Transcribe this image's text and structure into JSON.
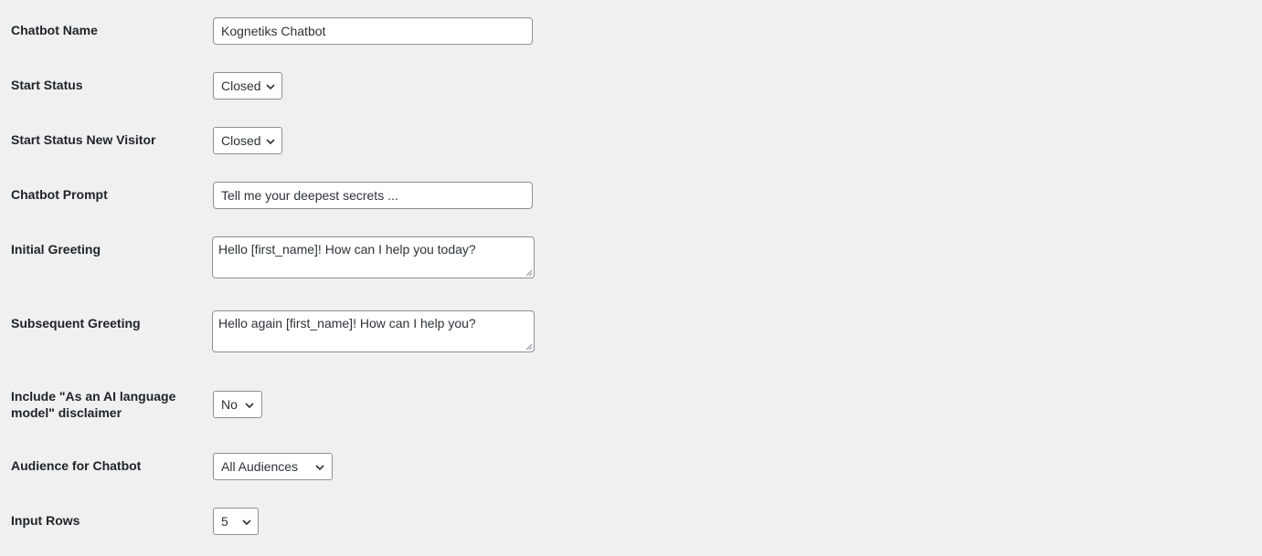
{
  "fields": {
    "chatbot_name": {
      "label": "Chatbot Name",
      "value": "Kognetiks Chatbot"
    },
    "start_status": {
      "label": "Start Status",
      "value": "Closed"
    },
    "start_status_new_visitor": {
      "label": "Start Status New Visitor",
      "value": "Closed"
    },
    "chatbot_prompt": {
      "label": "Chatbot Prompt",
      "value": "Tell me your deepest secrets ..."
    },
    "initial_greeting": {
      "label": "Initial Greeting",
      "value": "Hello [first_name]! How can I help you today?"
    },
    "subsequent_greeting": {
      "label": "Subsequent Greeting",
      "value": "Hello again [first_name]! How can I help you?"
    },
    "disclaimer": {
      "label": "Include \"As an AI language model\" disclaimer",
      "value": "No"
    },
    "audience": {
      "label": "Audience for Chatbot",
      "value": "All Audiences"
    },
    "input_rows": {
      "label": "Input Rows",
      "value": "5"
    }
  },
  "icons": {
    "select_arrow": "chevron-down-icon",
    "resize_grip": "resize-grip-icon"
  },
  "colors": {
    "background": "#f0f0f1",
    "input_border": "#8c8f94",
    "text": "#1d2327"
  }
}
